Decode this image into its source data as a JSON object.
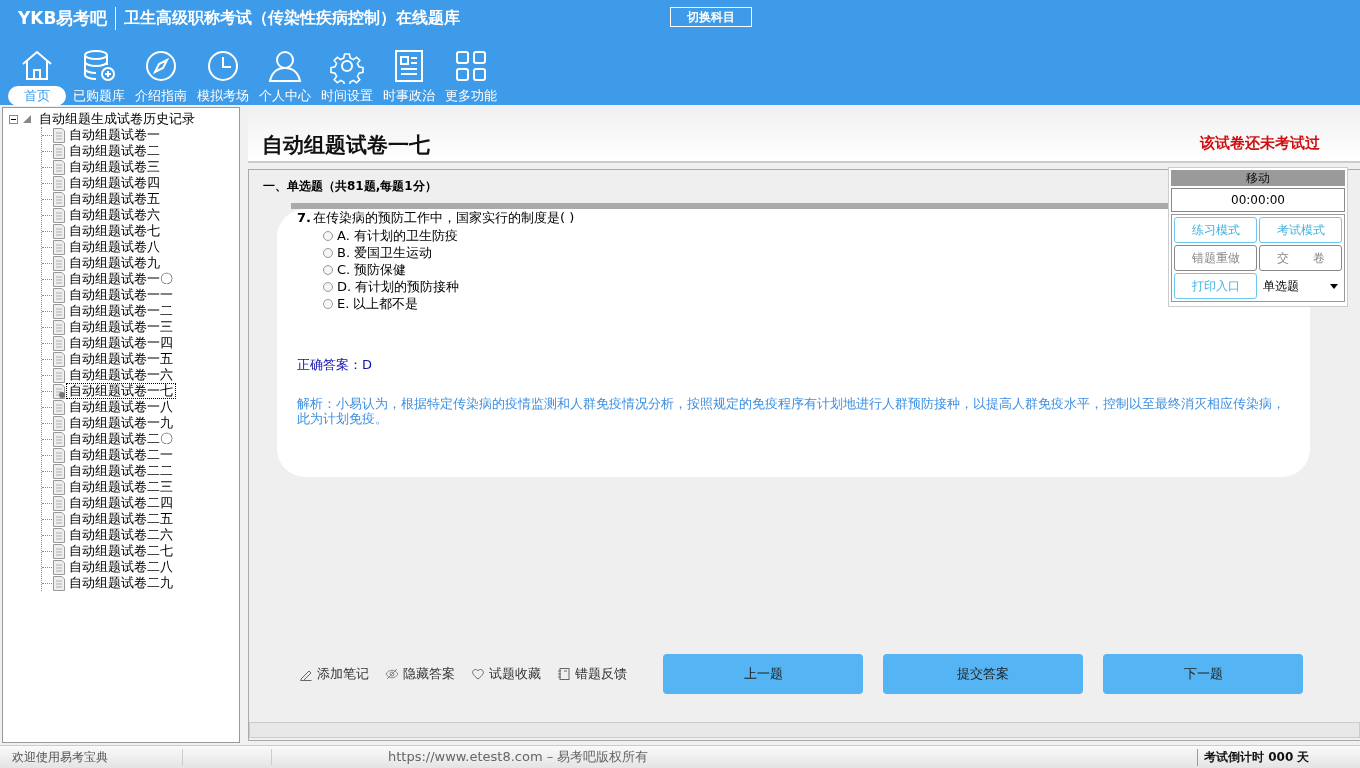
{
  "header": {
    "logo": "YKB易考吧",
    "title": "卫生高级职称考试（传染性疾病控制）在线题库",
    "switch_button": "切换科目"
  },
  "nav": [
    {
      "label": "首页",
      "selected": true
    },
    {
      "label": "已购题库",
      "selected": false
    },
    {
      "label": "介绍指南",
      "selected": false
    },
    {
      "label": "模拟考场",
      "selected": false
    },
    {
      "label": "个人中心",
      "selected": false
    },
    {
      "label": "时间设置",
      "selected": false
    },
    {
      "label": "时事政治",
      "selected": false
    },
    {
      "label": "更多功能",
      "selected": false
    }
  ],
  "tree": {
    "label": "自动组题生成试卷历史记录",
    "expanded": true,
    "children": [
      {
        "label": "自动组题试卷一",
        "selected": false
      },
      {
        "label": "自动组题试卷二",
        "selected": false
      },
      {
        "label": "自动组题试卷三",
        "selected": false
      },
      {
        "label": "自动组题试卷四",
        "selected": false
      },
      {
        "label": "自动组题试卷五",
        "selected": false
      },
      {
        "label": "自动组题试卷六",
        "selected": false
      },
      {
        "label": "自动组题试卷七",
        "selected": false
      },
      {
        "label": "自动组题试卷八",
        "selected": false
      },
      {
        "label": "自动组题试卷九",
        "selected": false
      },
      {
        "label": "自动组题试卷一〇",
        "selected": false
      },
      {
        "label": "自动组题试卷一一",
        "selected": false
      },
      {
        "label": "自动组题试卷一二",
        "selected": false
      },
      {
        "label": "自动组题试卷一三",
        "selected": false
      },
      {
        "label": "自动组题试卷一四",
        "selected": false
      },
      {
        "label": "自动组题试卷一五",
        "selected": false
      },
      {
        "label": "自动组题试卷一六",
        "selected": false
      },
      {
        "label": "自动组题试卷一七",
        "selected": true
      },
      {
        "label": "自动组题试卷一八",
        "selected": false
      },
      {
        "label": "自动组题试卷一九",
        "selected": false
      },
      {
        "label": "自动组题试卷二〇",
        "selected": false
      },
      {
        "label": "自动组题试卷二一",
        "selected": false
      },
      {
        "label": "自动组题试卷二二",
        "selected": false
      },
      {
        "label": "自动组题试卷二三",
        "selected": false
      },
      {
        "label": "自动组题试卷二四",
        "selected": false
      },
      {
        "label": "自动组题试卷二五",
        "selected": false
      },
      {
        "label": "自动组题试卷二六",
        "selected": false
      },
      {
        "label": "自动组题试卷二七",
        "selected": false
      },
      {
        "label": "自动组题试卷二八",
        "selected": false
      },
      {
        "label": "自动组题试卷二九",
        "selected": false
      }
    ]
  },
  "exam": {
    "title": "自动组题试卷一七",
    "status": "该试卷还未考试过",
    "section": "一、单选题（共81题,每题1分）",
    "question": {
      "number": "7.",
      "text": "在传染病的预防工作中，国家实行的制度是( )",
      "options": [
        {
          "label": "A. 有计划的卫生防疫",
          "selected": false
        },
        {
          "label": "B. 爱国卫生运动",
          "selected": false
        },
        {
          "label": "C. 预防保健",
          "selected": false
        },
        {
          "label": "D. 有计划的预防接种",
          "selected": false
        },
        {
          "label": "E. 以上都不是",
          "selected": false
        }
      ],
      "answer": "正确答案：D",
      "analysis": "解析：小易认为，根据特定传染病的疫情监测和人群免疫情况分析，按照规定的免疫程序有计划地进行人群预防接种，以提高人群免疫水平，控制以至最终消灭相应传染病，此为计划免疫。"
    },
    "tools": [
      "添加笔记",
      "隐藏答案",
      "试题收藏",
      "错题反馈"
    ],
    "buttons": [
      "上一题",
      "提交答案",
      "下一题"
    ]
  },
  "control_panel": {
    "title": "移动",
    "timer": "00:00:00",
    "buttons": [
      {
        "label": "练习模式",
        "disabled": false
      },
      {
        "label": "考试模式",
        "disabled": false
      },
      {
        "label": "错题重做",
        "disabled": true
      },
      {
        "label": "交　　卷",
        "disabled": true
      },
      {
        "label": "打印入口",
        "disabled": false
      }
    ],
    "type_select": "单选题"
  },
  "status_bar": {
    "welcome": "欢迎使用易考宝典",
    "copyright": "https://www.etest8.com – 易考吧版权所有",
    "countdown": "考试倒计时 000 天"
  }
}
